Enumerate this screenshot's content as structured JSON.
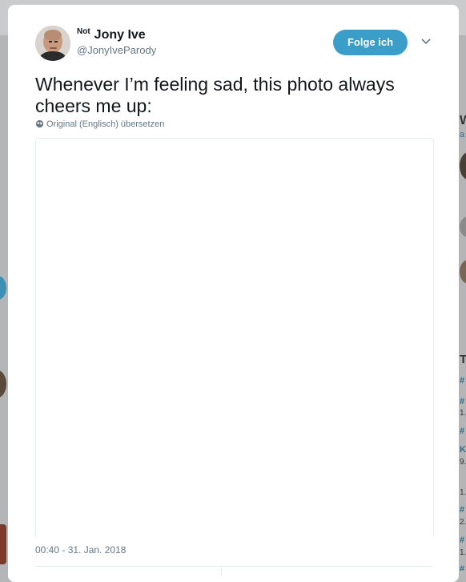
{
  "tweet": {
    "author": {
      "prefix": "Not",
      "name": "Jony Ive",
      "handle": "@JonyIveParody"
    },
    "follow_label": "Folge ich",
    "text": "Whenever I’m feeling sad, this photo always cheers me up:",
    "translate_label": "Original (Englisch) übersetzen",
    "timestamp": "00:40 - 31. Jan. 2018"
  },
  "background": {
    "right_snippets": [
      "W",
      "a",
      "#",
      "#",
      "1.",
      "#",
      "K",
      "9.",
      "1.",
      "#",
      "2.",
      "#",
      "1.",
      "#",
      "@"
    ],
    "right_title": "T"
  },
  "colors": {
    "follow_button": "#3b9ec9",
    "secondary_text": "#657786",
    "primary_text": "#14171a",
    "link": "#2a6d8c"
  }
}
